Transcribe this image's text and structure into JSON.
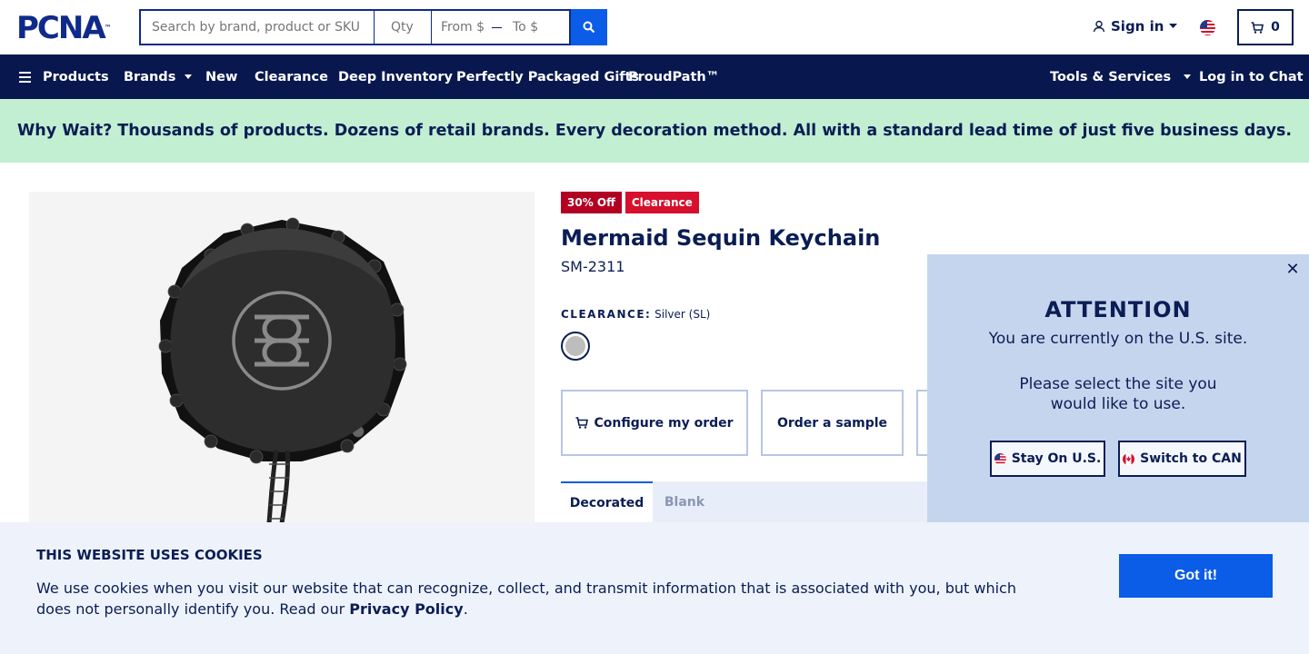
{
  "header": {
    "logo_text": "PCNA",
    "logo_tm": "™",
    "search": {
      "placeholder": "Search by brand, product or SKU"
    },
    "qty": {
      "placeholder": "Qty"
    },
    "price_from": {
      "placeholder": "From $"
    },
    "price_to": {
      "placeholder": "To $"
    },
    "signin_label": "Sign in",
    "cart_count": "0"
  },
  "nav": {
    "items": [
      {
        "label": "Products"
      },
      {
        "label": "Brands"
      },
      {
        "label": "New"
      },
      {
        "label": "Clearance"
      },
      {
        "label": "Deep Inventory"
      },
      {
        "label": "Perfectly Packaged Gifts"
      },
      {
        "label": "ProudPath™"
      }
    ],
    "tools_label": "Tools & Services",
    "chat_label": "Log in to Chat"
  },
  "banner": {
    "text": "Why Wait? Thousands of products. Dozens of retail brands. Every decoration method. All with a standard lead time of just five business days."
  },
  "product": {
    "badges": [
      "30% Off",
      "Clearance"
    ],
    "title": "Mermaid Sequin Keychain",
    "sku": "SM-2311",
    "color_heading": "CLEARANCE:",
    "color_value": "Silver (SL)",
    "actions": [
      "Configure my order",
      "Order a sample"
    ],
    "tabs": [
      "Decorated",
      "Blank"
    ]
  },
  "region_modal": {
    "title": "ATTENTION",
    "line1": "You are currently on the U.S. site.",
    "line2": "Please select the site you would like to use.",
    "stay_label": "Stay On U.S.",
    "switch_label": "Switch to CAN"
  },
  "cookie": {
    "title": "THIS WEBSITE USES COOKIES",
    "text": "We use cookies when you visit our website that can recognize, collect, and transmit information that is associated with you, but which does not personally identify you. Read our ",
    "link": "Privacy Policy",
    "tail": ".",
    "button": "Got it!"
  },
  "colors": {
    "navy": "#08184f",
    "brand_blue": "#0b5ce6",
    "banner_green": "#c2eed2",
    "sale_red": "#b30022"
  }
}
